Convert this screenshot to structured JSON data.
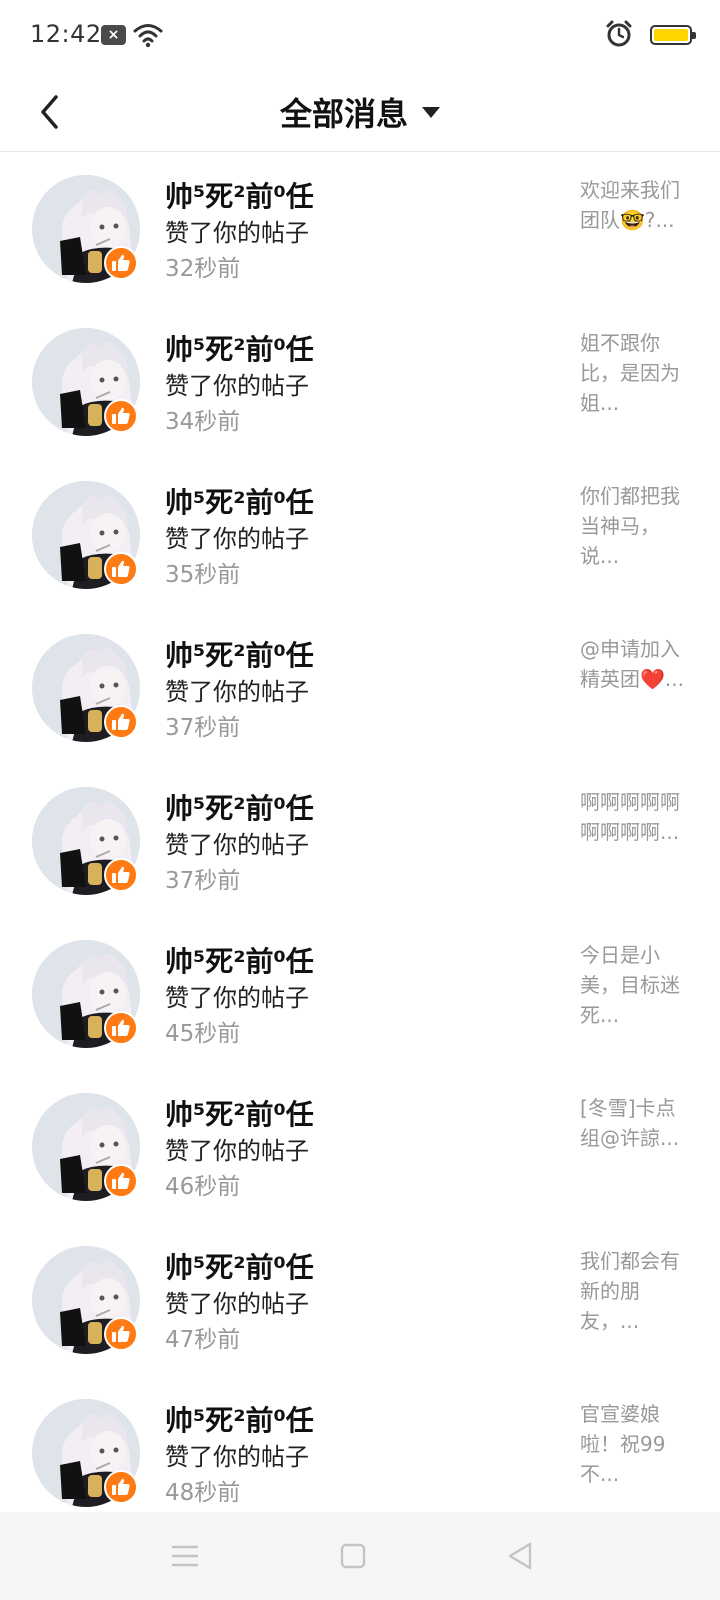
{
  "status_bar": {
    "time": "12:42",
    "icons": [
      "close-notification-icon",
      "wifi-icon",
      "alarm-icon",
      "battery-icon"
    ],
    "battery_color": "#ffd500"
  },
  "header": {
    "back_icon": "chevron-left-icon",
    "title": "全部消息",
    "dropdown_icon": "caret-down-icon"
  },
  "colors": {
    "like_badge": "#ff7a12",
    "meta_text": "#999999"
  },
  "notifications": [
    {
      "user": "帅⁵死²前⁰任",
      "action": "赞了你的帖子",
      "time": "32秒前",
      "preview": "欢迎来我们团队🤓?..."
    },
    {
      "user": "帅⁵死²前⁰任",
      "action": "赞了你的帖子",
      "time": "34秒前",
      "preview": "姐不跟你比，是因为姐..."
    },
    {
      "user": "帅⁵死²前⁰任",
      "action": "赞了你的帖子",
      "time": "35秒前",
      "preview": "你们都把我当神马，说..."
    },
    {
      "user": "帅⁵死²前⁰任",
      "action": "赞了你的帖子",
      "time": "37秒前",
      "preview": "@申请加入精英团❤️..."
    },
    {
      "user": "帅⁵死²前⁰任",
      "action": "赞了你的帖子",
      "time": "37秒前",
      "preview": " 啊啊啊啊啊啊啊啊啊..."
    },
    {
      "user": "帅⁵死²前⁰任",
      "action": "赞了你的帖子",
      "time": "45秒前",
      "preview": "今日是小美，目标迷死..."
    },
    {
      "user": "帅⁵死²前⁰任",
      "action": "赞了你的帖子",
      "time": "46秒前",
      "preview": "[冬雪]卡点组@许諒..."
    },
    {
      "user": "帅⁵死²前⁰任",
      "action": "赞了你的帖子",
      "time": "47秒前",
      "preview": "我们都会有新的朋友，..."
    },
    {
      "user": "帅⁵死²前⁰任",
      "action": "赞了你的帖子",
      "time": "48秒前",
      "preview": "官宣婆娘啦！祝99不..."
    }
  ],
  "nav_bar": {
    "buttons": [
      "menu-icon",
      "home-square-icon",
      "back-triangle-icon"
    ]
  }
}
